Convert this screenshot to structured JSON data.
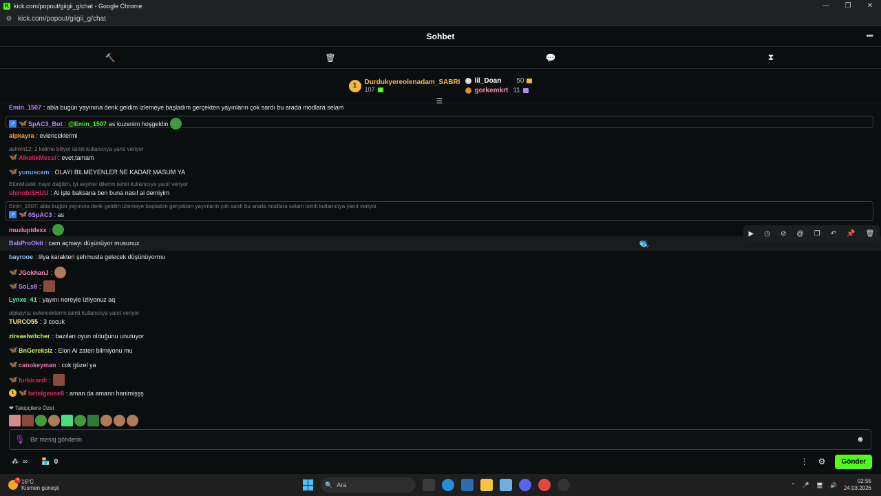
{
  "window": {
    "title": "kick.com/popout/giigii_g/chat - Google Chrome",
    "url": "kick.com/popout/giigii_g/chat"
  },
  "chat": {
    "title": "Sohbet"
  },
  "leaderboard": {
    "first": {
      "rank": "1",
      "name": "Durdukyereolenadam_SABRI",
      "count": "107"
    },
    "second": {
      "name": "lil_Doan",
      "count": "50"
    },
    "third": {
      "name": "gorkemkrt",
      "count": "11"
    }
  },
  "messages": {
    "m0": {
      "user": "Emin_1507",
      "text": ": abla bugün yayınına denk geldim izlemeye başladım gerçekten yayınların çok sardı bu arada modlara selam"
    },
    "m1": {
      "user": "SpAC3_Bot",
      "text": ": ",
      "mention": "@Emin_1507",
      "text2": " as kuzenim hoşgeldin"
    },
    "m2": {
      "user": "alpkayra",
      "text": ": evlenceklermi"
    },
    "m3": {
      "reply": "asimm12: 2 kelime biliyor isimli kullanıcıya yanıt veriyor",
      "user": "AlkolikMessi",
      "text": ": evet,tamam"
    },
    "m4": {
      "user": "yunuscam",
      "text": ": OLAYI BILMEYENLER NE KADAR MASUM YA"
    },
    "m5": {
      "reply": "ElonMusikl: hayır değilim, iyi seyirler dilerim isimli kullanıcıya yanıt veriyor",
      "user": "shinobiSHUU",
      "text": ": Al işte baksana ben buna nasıl ai demiyim"
    },
    "m6": {
      "reply": "Emin_1507: abla bugün yayınına denk geldim izlemeye başladım gerçekten yayınların çok sardı bu arada modlara selam isimli kullanıcıya yanıt veriyor",
      "user": "0SpAC3",
      "text": ": as"
    },
    "m7": {
      "user": "muzlupidexx",
      "text": ":"
    },
    "m8": {
      "user": "BabProOkti",
      "text": ": cam açmayı düşünüyor musunuz"
    },
    "m9": {
      "user": "bayrooe",
      "text": ": lilya karakteri şehmusla gelecek düşünüyormu"
    },
    "m10": {
      "user": "JGokhanJ",
      "text": ":"
    },
    "m11": {
      "user": "SoLs8",
      "text": ":"
    },
    "m12": {
      "user": "Lynxe_41",
      "text": ": yayını nereyle izliyonuz aq"
    },
    "m13": {
      "reply": "alpkayra: evlenceklermi isimli kullanıcıya yanıt veriyor",
      "user": "TURCO55",
      "text": ": 3 cocuk"
    },
    "m14": {
      "user": "zireaelwitcher",
      "text": ": bazıları oyun olduğunu unutuyor"
    },
    "m15": {
      "user": "BnGereksiz",
      "text": ": Elon Ai zaten bilmiyonu mu"
    },
    "m16": {
      "user": "canokeyman",
      "text": ": cok güzel ya"
    },
    "m17": {
      "user": "furkicardi",
      "text": ":"
    },
    "m18": {
      "user": "betelgeuse8",
      "text": ": aman da amann hanimişşş",
      "badge": "1"
    }
  },
  "followers": {
    "label": "❤ Takipçilere Özel"
  },
  "input": {
    "placeholder": "Bir mesaj gönderin",
    "value": ""
  },
  "bottom": {
    "infinity": "∞",
    "count": "0",
    "send_label": "Gönder"
  },
  "taskbar": {
    "weather_temp": "16°C",
    "weather_desc": "Kısmen güneşli",
    "weather_badge": "4",
    "search_placeholder": "Ara",
    "time": "02:55",
    "date": "24.03.2026"
  },
  "colors": {
    "accent": "#53fc18",
    "gold": "#f4b942"
  }
}
